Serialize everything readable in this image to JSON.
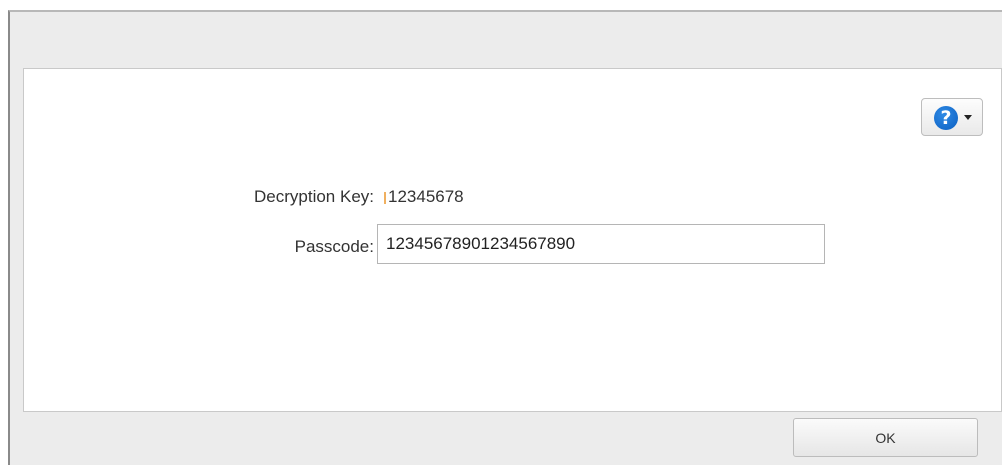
{
  "dialog": {
    "help": {
      "icon": "question-circle-icon",
      "glyph": "?",
      "dropdown_icon": "caret-down-icon",
      "accent_color": "#0b6fd6"
    },
    "fields": {
      "decryption_key_label": "Decryption Key:",
      "decryption_key_value": "12345678",
      "passcode_label": "Passcode:",
      "passcode_value": "12345678901234567890"
    },
    "buttons": {
      "ok_label": "OK"
    }
  }
}
